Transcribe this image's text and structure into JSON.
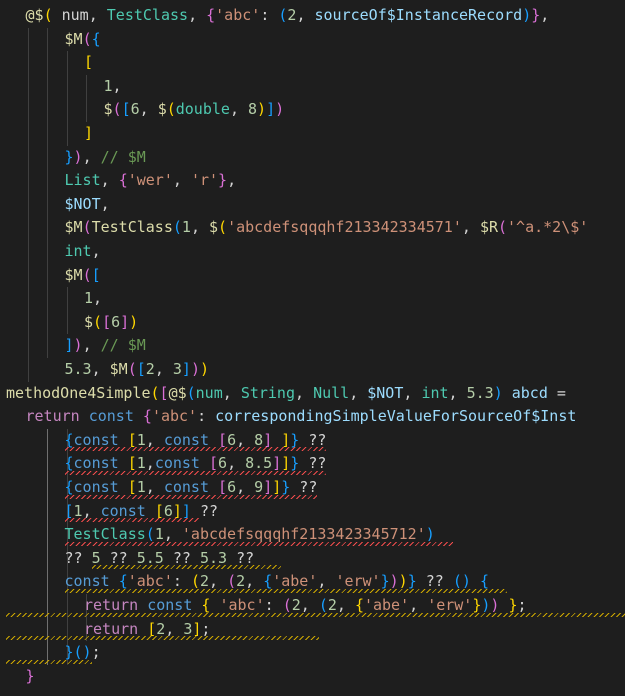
{
  "editor": {
    "language": "dart",
    "theme": "dark",
    "lines": [
      {
        "indent": 1,
        "tokens": [
          [
            "@$",
            "fn"
          ],
          [
            "(",
            "b1"
          ],
          [
            " num, ",
            "def"
          ],
          [
            "TestClass",
            "cls"
          ],
          [
            ", ",
            "def"
          ],
          [
            "{",
            "b2"
          ],
          [
            "'abc'",
            "str"
          ],
          [
            ": ",
            "def"
          ],
          [
            "(",
            "b3"
          ],
          [
            "2",
            "num"
          ],
          [
            ", ",
            "def"
          ],
          [
            "sourceOf$InstanceRecord",
            "var"
          ],
          [
            ")",
            "b3"
          ],
          [
            "}",
            "b2"
          ],
          [
            ",",
            "def"
          ]
        ]
      },
      {
        "indent": 3,
        "tokens": [
          [
            "$M",
            "fn"
          ],
          [
            "(",
            "b2"
          ],
          [
            "{",
            "b3"
          ]
        ]
      },
      {
        "indent": 4,
        "tokens": [
          [
            "[",
            "b1"
          ]
        ]
      },
      {
        "indent": 5,
        "tokens": [
          [
            "1",
            "num"
          ],
          [
            ",",
            "def"
          ]
        ]
      },
      {
        "indent": 5,
        "tokens": [
          [
            "$",
            "fn"
          ],
          [
            "(",
            "b2"
          ],
          [
            "[",
            "b3"
          ],
          [
            "6",
            "num"
          ],
          [
            ", ",
            "def"
          ],
          [
            "$",
            "fn"
          ],
          [
            "(",
            "b1"
          ],
          [
            "double",
            "cls"
          ],
          [
            ", ",
            "def"
          ],
          [
            "8",
            "num"
          ],
          [
            ")",
            "b1"
          ],
          [
            "]",
            "b3"
          ],
          [
            ")",
            "b2"
          ]
        ]
      },
      {
        "indent": 4,
        "tokens": [
          [
            "]",
            "b1"
          ]
        ]
      },
      {
        "indent": 3,
        "tokens": [
          [
            "}",
            "b3"
          ],
          [
            ")",
            "b2"
          ],
          [
            ", ",
            "def"
          ],
          [
            "// $M",
            "com"
          ]
        ]
      },
      {
        "indent": 3,
        "tokens": [
          [
            "List",
            "cls"
          ],
          [
            ", ",
            "def"
          ],
          [
            "{",
            "b2"
          ],
          [
            "'wer'",
            "str"
          ],
          [
            ", ",
            "def"
          ],
          [
            "'r'",
            "str"
          ],
          [
            "}",
            "b2"
          ],
          [
            ",",
            "def"
          ]
        ]
      },
      {
        "indent": 3,
        "tokens": [
          [
            "$NOT",
            "var"
          ],
          [
            ",",
            "def"
          ]
        ]
      },
      {
        "indent": 3,
        "tokens": [
          [
            "$M",
            "fn"
          ],
          [
            "(",
            "b2"
          ],
          [
            "TestClass",
            "fn"
          ],
          [
            "(",
            "b3"
          ],
          [
            "1",
            "num"
          ],
          [
            ", ",
            "def"
          ],
          [
            "$",
            "fn"
          ],
          [
            "(",
            "b1"
          ],
          [
            "'abcdefsqqqhf213342334571'",
            "str"
          ],
          [
            ", ",
            "def"
          ],
          [
            "$R",
            "fn"
          ],
          [
            "(",
            "b2"
          ],
          [
            "'^a.*2\\$'",
            "str"
          ]
        ]
      },
      {
        "indent": 3,
        "tokens": [
          [
            "int",
            "cls"
          ],
          [
            ",",
            "def"
          ]
        ]
      },
      {
        "indent": 3,
        "tokens": [
          [
            "$M",
            "fn"
          ],
          [
            "(",
            "b2"
          ],
          [
            "[",
            "b3"
          ]
        ]
      },
      {
        "indent": 4,
        "tokens": [
          [
            "1",
            "num"
          ],
          [
            ",",
            "def"
          ]
        ]
      },
      {
        "indent": 4,
        "tokens": [
          [
            "$",
            "fn"
          ],
          [
            "(",
            "b1"
          ],
          [
            "[",
            "b2"
          ],
          [
            "6",
            "num"
          ],
          [
            "]",
            "b2"
          ],
          [
            ")",
            "b1"
          ]
        ]
      },
      {
        "indent": 3,
        "tokens": [
          [
            "]",
            "b3"
          ],
          [
            ")",
            "b2"
          ],
          [
            ", ",
            "def"
          ],
          [
            "// $M",
            "com"
          ]
        ]
      },
      {
        "indent": 3,
        "tokens": [
          [
            "5.3",
            "num"
          ],
          [
            ", ",
            "def"
          ],
          [
            "$M",
            "fn"
          ],
          [
            "(",
            "b2"
          ],
          [
            "[",
            "b3"
          ],
          [
            "2",
            "num"
          ],
          [
            ", ",
            "def"
          ],
          [
            "3",
            "num"
          ],
          [
            "]",
            "b3"
          ],
          [
            ")",
            "b2"
          ],
          [
            ")",
            "b1"
          ]
        ]
      },
      {
        "indent": 0,
        "tokens": [
          [
            "methodOne4Simple",
            "fn"
          ],
          [
            "(",
            "b1"
          ],
          [
            "[",
            "b2"
          ],
          [
            "@$",
            "fn"
          ],
          [
            "(",
            "b3"
          ],
          [
            "num",
            "cls"
          ],
          [
            ", ",
            "def"
          ],
          [
            "String",
            "cls"
          ],
          [
            ", ",
            "def"
          ],
          [
            "Null",
            "cls"
          ],
          [
            ", ",
            "def"
          ],
          [
            "$NOT",
            "var"
          ],
          [
            ", ",
            "def"
          ],
          [
            "int",
            "cls"
          ],
          [
            ", ",
            "def"
          ],
          [
            "5.3",
            "num"
          ],
          [
            ")",
            "b3"
          ],
          [
            " ",
            "def"
          ],
          [
            "abcd",
            "var"
          ],
          [
            " =",
            "def"
          ]
        ]
      },
      {
        "indent": 1,
        "tokens": [
          [
            "return",
            "ctl"
          ],
          [
            " ",
            "def"
          ],
          [
            "const",
            "kw"
          ],
          [
            " ",
            "def"
          ],
          [
            "{",
            "b2"
          ],
          [
            "'abc'",
            "str"
          ],
          [
            ": ",
            "def"
          ],
          [
            "correspondingSimpleValueForSourceOf$Inst",
            "var"
          ]
        ]
      },
      {
        "indent": 3,
        "tokens": [
          [
            "{",
            "b3"
          ],
          [
            "const",
            "kw"
          ],
          [
            " ",
            "def"
          ],
          [
            "[",
            "b1"
          ],
          [
            "1",
            "num"
          ],
          [
            ", ",
            "def"
          ],
          [
            "const",
            "kw"
          ],
          [
            " ",
            "def"
          ],
          [
            "[",
            "b2"
          ],
          [
            "6",
            "num"
          ],
          [
            ", ",
            "def"
          ],
          [
            "8",
            "num"
          ],
          [
            "]",
            "b2"
          ],
          [
            " ",
            "def"
          ],
          [
            "]",
            "b1"
          ],
          [
            "}",
            "b3"
          ],
          [
            " ??",
            "def"
          ]
        ]
      },
      {
        "indent": 3,
        "tokens": [
          [
            "{",
            "b3"
          ],
          [
            "const",
            "kw"
          ],
          [
            " ",
            "def"
          ],
          [
            "[",
            "b1"
          ],
          [
            "1",
            "num"
          ],
          [
            ",",
            "def"
          ],
          [
            "const",
            "kw"
          ],
          [
            " ",
            "def"
          ],
          [
            "[",
            "b2"
          ],
          [
            "6",
            "num"
          ],
          [
            ", ",
            "def"
          ],
          [
            "8.5",
            "num"
          ],
          [
            "]",
            "b2"
          ],
          [
            "]",
            "b1"
          ],
          [
            "}",
            "b3"
          ],
          [
            " ??",
            "def"
          ]
        ]
      },
      {
        "indent": 3,
        "tokens": [
          [
            "{",
            "b3"
          ],
          [
            "const",
            "kw"
          ],
          [
            " ",
            "def"
          ],
          [
            "[",
            "b1"
          ],
          [
            "1",
            "num"
          ],
          [
            ", ",
            "def"
          ],
          [
            "const",
            "kw"
          ],
          [
            " ",
            "def"
          ],
          [
            "[",
            "b2"
          ],
          [
            "6",
            "num"
          ],
          [
            ", ",
            "def"
          ],
          [
            "9",
            "num"
          ],
          [
            "]",
            "b2"
          ],
          [
            "]",
            "b1"
          ],
          [
            "}",
            "b3"
          ],
          [
            " ??",
            "def"
          ]
        ]
      },
      {
        "indent": 3,
        "tokens": [
          [
            "[",
            "b3"
          ],
          [
            "1",
            "num"
          ],
          [
            ", ",
            "def"
          ],
          [
            "const",
            "kw"
          ],
          [
            " ",
            "def"
          ],
          [
            "[",
            "b1"
          ],
          [
            "6",
            "num"
          ],
          [
            "]",
            "b1"
          ],
          [
            "]",
            "b3"
          ],
          [
            " ??",
            "def"
          ]
        ]
      },
      {
        "indent": 3,
        "tokens": [
          [
            "TestClass",
            "cls"
          ],
          [
            "(",
            "b3"
          ],
          [
            "1",
            "num"
          ],
          [
            ", ",
            "def"
          ],
          [
            "'abcdefsqqqhf2133423345712'",
            "str"
          ],
          [
            ")",
            "b3"
          ]
        ]
      },
      {
        "indent": 3,
        "tokens": [
          [
            "?? ",
            "def"
          ],
          [
            "5",
            "num"
          ],
          [
            " ?? ",
            "def"
          ],
          [
            "5.5",
            "num"
          ],
          [
            " ?? ",
            "def"
          ],
          [
            "5.3",
            "num"
          ],
          [
            " ??",
            "def"
          ]
        ]
      },
      {
        "indent": 3,
        "tokens": [
          [
            "const",
            "kw"
          ],
          [
            " ",
            "def"
          ],
          [
            "{",
            "b3"
          ],
          [
            "'abc'",
            "str"
          ],
          [
            ": ",
            "def"
          ],
          [
            "(",
            "b1"
          ],
          [
            "2",
            "num"
          ],
          [
            ", ",
            "def"
          ],
          [
            "(",
            "b2"
          ],
          [
            "2",
            "num"
          ],
          [
            ", ",
            "def"
          ],
          [
            "{",
            "b3"
          ],
          [
            "'abe'",
            "str"
          ],
          [
            ", ",
            "def"
          ],
          [
            "'erw'",
            "str"
          ],
          [
            "}",
            "b3"
          ],
          [
            ")",
            "b2"
          ],
          [
            ")",
            "b1"
          ],
          [
            "}",
            "b3"
          ],
          [
            " ?? ",
            "def"
          ],
          [
            "()",
            "b3"
          ],
          [
            " ",
            "def"
          ],
          [
            "{",
            "b3"
          ]
        ]
      },
      {
        "indent": 4,
        "tokens": [
          [
            "return",
            "ctl"
          ],
          [
            " ",
            "def"
          ],
          [
            "const",
            "kw"
          ],
          [
            " ",
            "def"
          ],
          [
            "{",
            "b1"
          ],
          [
            " ",
            "def"
          ],
          [
            "'abc'",
            "str"
          ],
          [
            ": ",
            "def"
          ],
          [
            "(",
            "b2"
          ],
          [
            "2",
            "num"
          ],
          [
            ", ",
            "def"
          ],
          [
            "(",
            "b3"
          ],
          [
            "2",
            "num"
          ],
          [
            ", ",
            "def"
          ],
          [
            "{",
            "b1"
          ],
          [
            "'abe'",
            "str"
          ],
          [
            ", ",
            "def"
          ],
          [
            "'erw'",
            "str"
          ],
          [
            "}",
            "b1"
          ],
          [
            ")",
            "b3"
          ],
          [
            ")",
            "b2"
          ],
          [
            " ",
            "def"
          ],
          [
            "}",
            "b1"
          ],
          [
            ";",
            "def"
          ]
        ]
      },
      {
        "indent": 4,
        "tokens": [
          [
            "return",
            "ctl"
          ],
          [
            " ",
            "def"
          ],
          [
            "[",
            "b1"
          ],
          [
            "2",
            "num"
          ],
          [
            ", ",
            "def"
          ],
          [
            "3",
            "num"
          ],
          [
            "]",
            "b1"
          ],
          [
            ";",
            "def"
          ]
        ]
      },
      {
        "indent": 3,
        "tokens": [
          [
            "}",
            "b3"
          ],
          [
            "()",
            "b3"
          ],
          [
            ";",
            "def"
          ]
        ]
      },
      {
        "indent": 1,
        "tokens": [
          [
            "}",
            "b2"
          ]
        ]
      }
    ]
  }
}
